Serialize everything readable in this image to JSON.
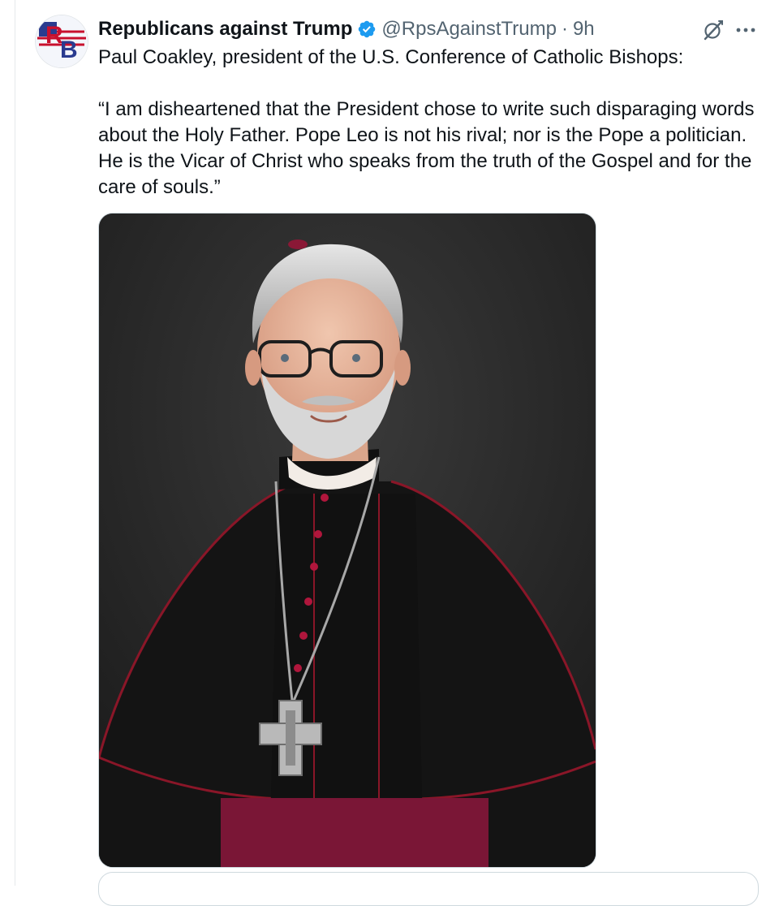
{
  "post": {
    "author": {
      "display_name": "Republicans against Trump",
      "handle": "@RpsAgainstTrump",
      "avatar_text": "RB",
      "verified": true
    },
    "separator": "·",
    "time": "9h",
    "text_lines": [
      "Paul Coakley, president of the U.S. Conference of Catholic Bishops:",
      "“I am disheartened that the President chose to write such disparaging words about the Holy Father. Pope Leo is not his rival; nor is the Pope a politician. He is the Vicar of Christ who speaks from the truth of the Gospel and for the care of souls.”"
    ],
    "media": {
      "kind": "portrait photo",
      "subject": "man with gray hair and beard, glasses, black cassock with red piping and buttons, pectoral cross"
    }
  },
  "icons": {
    "verified": "verified-badge-icon",
    "grok": "grok-icon",
    "more": "more-options-icon"
  },
  "colors": {
    "verified_blue": "#1d9bf0",
    "secondary_text": "#536471",
    "primary_text": "#0f1419",
    "border": "#cfd9de"
  }
}
